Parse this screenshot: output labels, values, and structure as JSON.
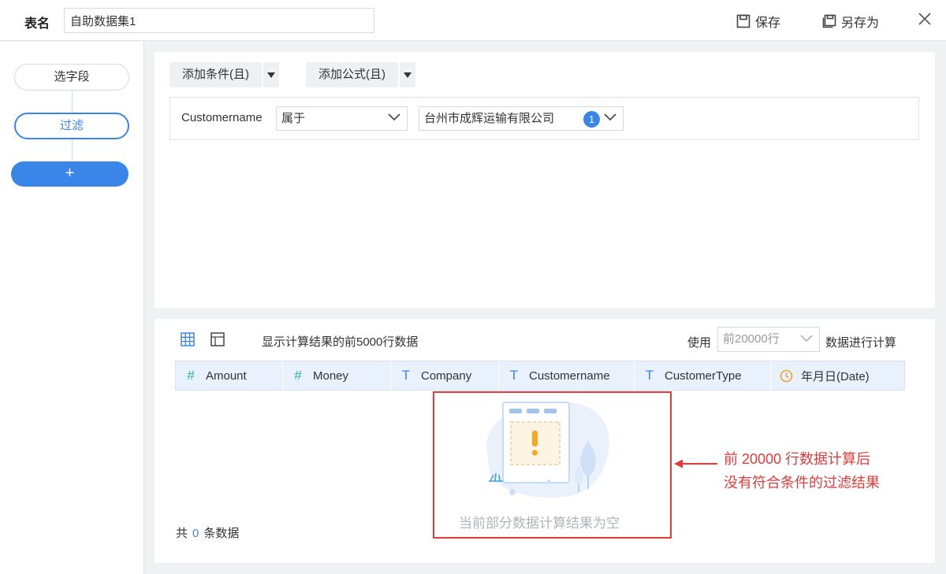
{
  "header": {
    "table_label": "表名",
    "table_name": "自助数据集1",
    "save_label": "保存",
    "save_as_label": "另存为"
  },
  "sidebar": {
    "steps": [
      {
        "label": "选字段"
      },
      {
        "label": "过滤"
      },
      {
        "label": "+"
      }
    ]
  },
  "filter": {
    "add_condition_label": "添加条件(且)",
    "add_formula_label": "添加公式(且)",
    "condition": {
      "field": "Customername",
      "operator": "属于",
      "value": "台州市成辉运输有限公司",
      "value_count": "1"
    }
  },
  "preview": {
    "description": "显示计算结果的前5000行数据",
    "use_label": "使用",
    "rows_option": "前20000行",
    "compute_label": "数据进行计算",
    "columns": [
      {
        "type_icon": "#",
        "name": "Amount"
      },
      {
        "type_icon": "#",
        "name": "Money"
      },
      {
        "type_icon": "T",
        "name": "Company"
      },
      {
        "type_icon": "T",
        "name": "Customername"
      },
      {
        "type_icon": "T",
        "name": "CustomerType"
      },
      {
        "type_icon": "clock-icon",
        "name": "年月日(Date)"
      }
    ],
    "empty_message": "当前部分数据计算结果为空",
    "total_prefix": "共",
    "total_count": "0",
    "total_suffix": "条数据"
  },
  "annotation": {
    "line1": "前 20000 行数据计算后",
    "line2": "没有符合条件的过滤结果"
  },
  "colors": {
    "accent": "#3a86e8",
    "annotation_red": "#e23b3b",
    "number_type": "#2bb39a",
    "date_type": "#f0a030"
  }
}
